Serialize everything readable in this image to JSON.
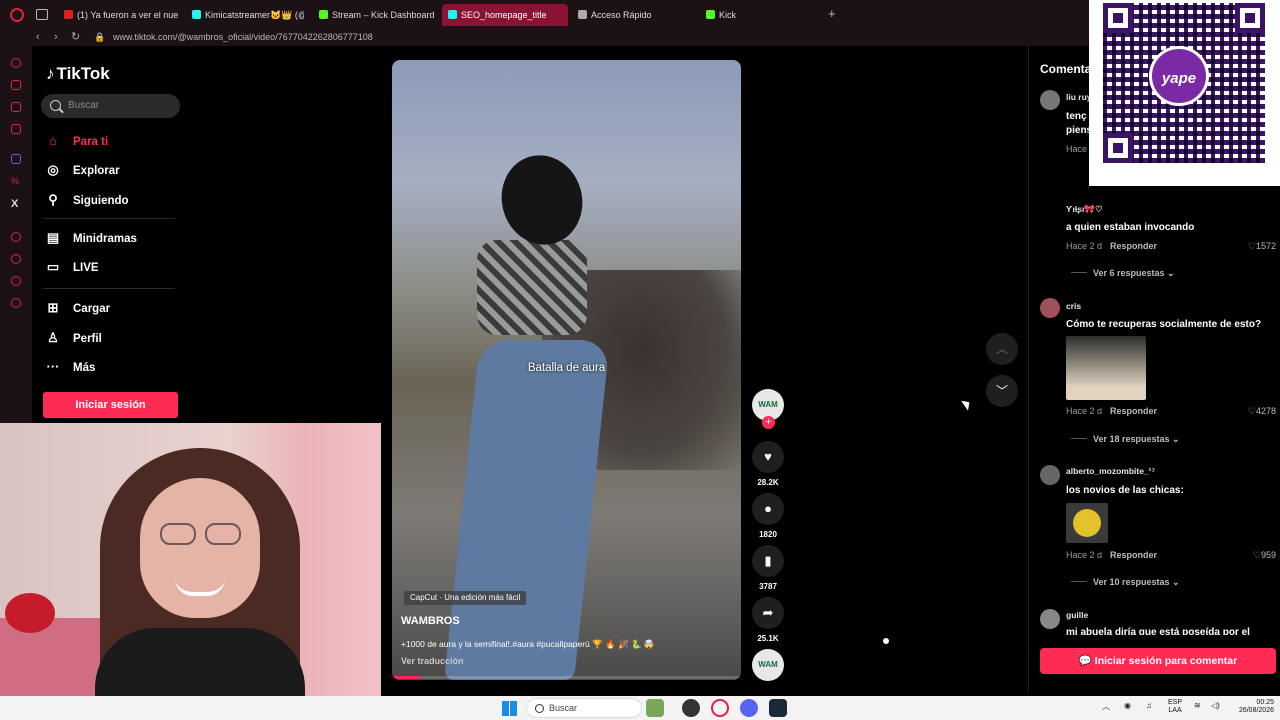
{
  "browser": {
    "tabs": [
      {
        "label": "(1) Ya fueron a ver el nuevo",
        "color": "#e02020"
      },
      {
        "label": "Kimicatstreamer🐱👑 (@k",
        "color": "#25f4ee"
      },
      {
        "label": "Stream – Kick Dashboard",
        "color": "#53fc18"
      },
      {
        "label": "SEO_homepage_title",
        "color": "#25f4ee"
      },
      {
        "label": "Acceso Rápido",
        "color": "#aaaaaa"
      },
      {
        "label": "Kick",
        "color": "#53fc18"
      }
    ],
    "new_tab": "+",
    "url": "www.tiktok.com/@wambros_oficial/video/7677042262806777108"
  },
  "tiktok": {
    "logo": "TikTok",
    "search_placeholder": "Buscar",
    "nav": [
      {
        "label": "Para ti",
        "icon": "⌂"
      },
      {
        "label": "Explorar",
        "icon": "◎"
      },
      {
        "label": "Siguiendo",
        "icon": "⚲"
      },
      {
        "label": "Minidramas",
        "icon": "▤"
      },
      {
        "label": "LIVE",
        "icon": "▭"
      },
      {
        "label": "Cargar",
        "icon": "⊞"
      },
      {
        "label": "Perfil",
        "icon": "♙"
      },
      {
        "label": "Más",
        "icon": "···"
      }
    ],
    "login_label": "Iniciar sesión",
    "accent": "#fe2c55"
  },
  "video": {
    "caption_overlay": "Batalla de aura",
    "capcut_label": "CapCut · Una edición más fácil",
    "author": "WAMBROS",
    "description": "+1000 de aura y la semifinal!.#aura #pucallpaperú 🏆 🔥 🎉 🐍 🤯",
    "translate_label": "Ver traducción",
    "progress": 0.08,
    "avatar_text": "WAM",
    "actions": [
      {
        "name": "like",
        "icon": "♥",
        "count": "28.2K"
      },
      {
        "name": "comment",
        "icon": "●",
        "count": "1820"
      },
      {
        "name": "save",
        "icon": "▮",
        "count": "3787"
      },
      {
        "name": "share",
        "icon": "➦",
        "count": "25.1K"
      }
    ],
    "nav_up": "︿",
    "nav_down": "﹀"
  },
  "comments": {
    "title": "Comentarios",
    "items": [
      {
        "user": "liu ruy",
        "text": "tenç piens",
        "meta": "Hace",
        "reply": "",
        "likes": "",
        "more": ""
      },
      {
        "user": "Ƴιƚʂι🎀♡",
        "text": "a quien estaban invocando",
        "meta": "Hace 2 d",
        "reply": "Responder",
        "likes": "♡1572",
        "more": "Ver 6 respuestas ⌄"
      },
      {
        "user": "cris",
        "text": "Cómo te recuperas socialmente de esto?",
        "meta": "Hace 2 d",
        "reply": "Responder",
        "likes": "♡4278",
        "more": "Ver 18 respuestas ⌄"
      },
      {
        "user": "alberto_mozombite_¹⁷",
        "text": "los novios de las chicas:",
        "meta": "Hace 2 d",
        "reply": "Responder",
        "likes": "♡959",
        "more": "Ver 10 respuestas ⌄"
      },
      {
        "user": "guille",
        "text": "mi abuela diría que está poseída por el",
        "meta": "",
        "reply": "",
        "likes": "",
        "more": ""
      }
    ],
    "login_label": "Iniciar sesión para comentar"
  },
  "qr": {
    "brand": "yape"
  },
  "taskbar": {
    "search_placeholder": "Buscar",
    "lang_top": "ESP",
    "lang_bottom": "LAA",
    "time": "00:25",
    "date": "26/08/2026"
  }
}
